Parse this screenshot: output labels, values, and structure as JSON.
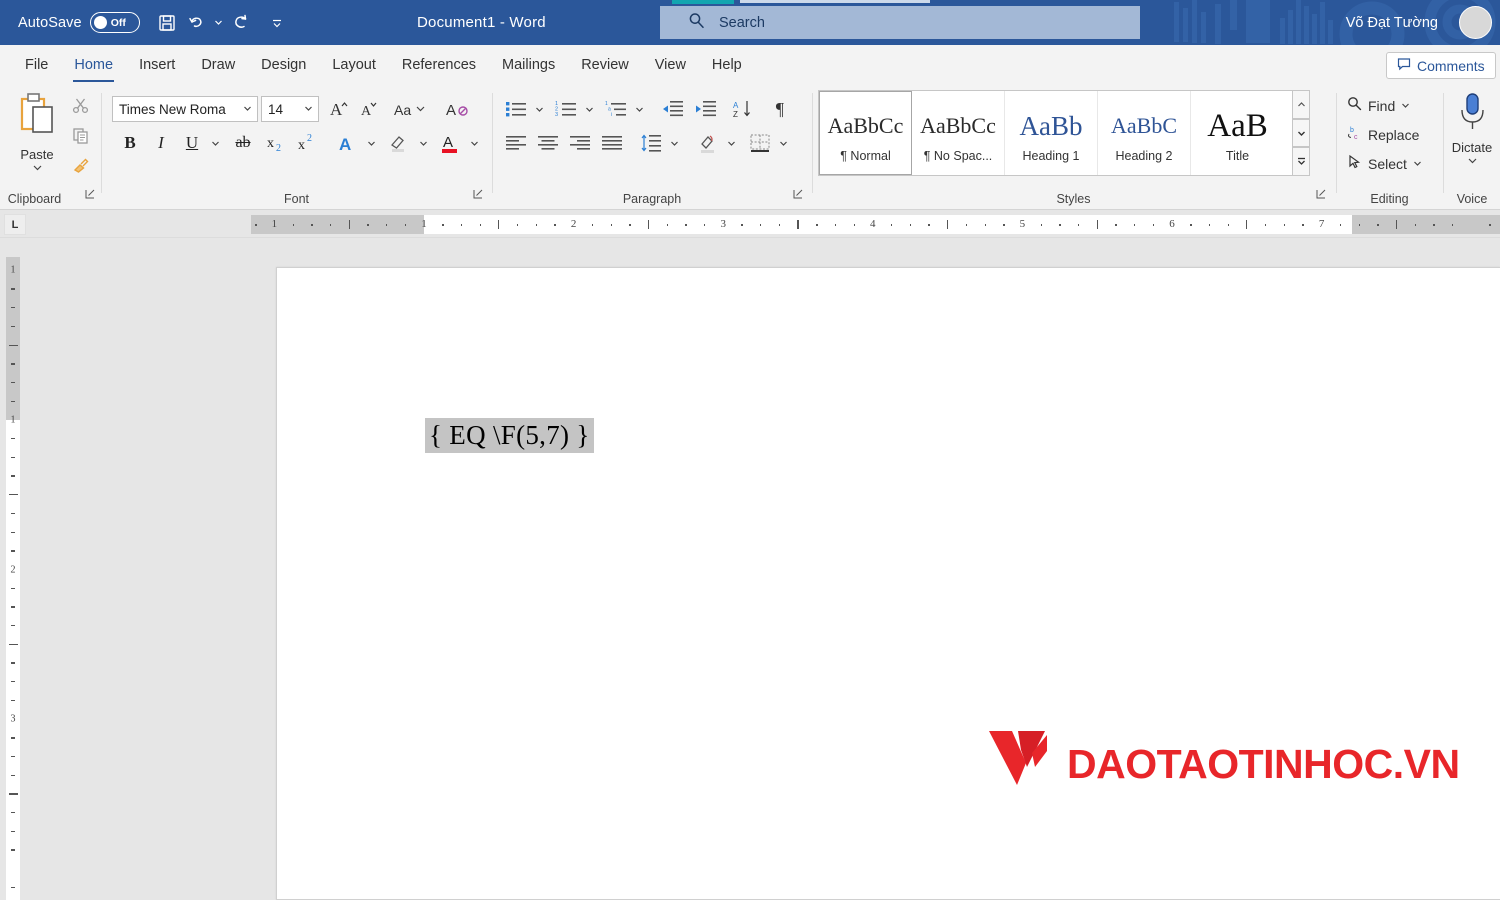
{
  "titlebar": {
    "autosave_label": "AutoSave",
    "autosave_state": "Off",
    "document_title": "Document1  -  Word",
    "search_placeholder": "Search",
    "search_value": "",
    "user_name": "Võ Đạt Tường",
    "qat": [
      {
        "name": "save-button",
        "label": "Save"
      },
      {
        "name": "undo-button",
        "label": "Undo"
      },
      {
        "name": "redo-button",
        "label": "Redo"
      },
      {
        "name": "customize-qat-button",
        "label": "Customize Quick Access Toolbar"
      }
    ],
    "accent_color": "#2b579a"
  },
  "ribbon_tabs": {
    "items": [
      {
        "label": "File",
        "active": false
      },
      {
        "label": "Home",
        "active": true
      },
      {
        "label": "Insert",
        "active": false
      },
      {
        "label": "Draw",
        "active": false
      },
      {
        "label": "Design",
        "active": false
      },
      {
        "label": "Layout",
        "active": false
      },
      {
        "label": "References",
        "active": false
      },
      {
        "label": "Mailings",
        "active": false
      },
      {
        "label": "Review",
        "active": false
      },
      {
        "label": "View",
        "active": false
      },
      {
        "label": "Help",
        "active": false
      }
    ],
    "comments_label": "Comments"
  },
  "ribbon": {
    "clipboard": {
      "group_label": "Clipboard",
      "paste_label": "Paste",
      "cut_label": "Cut",
      "copy_label": "Copy",
      "format_painter_label": "Format Painter"
    },
    "font": {
      "group_label": "Font",
      "font_name": "Times New Roma",
      "font_size": "14",
      "grow_font_label": "Grow Font",
      "shrink_font_label": "Shrink Font",
      "change_case_label": "Change Case",
      "clear_formatting_label": "Clear All Formatting",
      "bold_label": "B",
      "italic_label": "I",
      "underline_label": "U",
      "strikethrough_label": "ab",
      "subscript_label": "x",
      "superscript_label": "x",
      "text_effects_label": "A",
      "highlight_label": "Text Highlight Color",
      "font_color_label": "Font Color",
      "font_color_value": "#e81123"
    },
    "paragraph": {
      "group_label": "Paragraph",
      "bullets_label": "Bullets",
      "numbering_label": "Numbering",
      "multilevel_label": "Multilevel List",
      "decrease_indent_label": "Decrease Indent",
      "increase_indent_label": "Increase Indent",
      "sort_label": "Sort",
      "show_marks_label": "¶",
      "align_left_label": "Align Left",
      "align_center_label": "Center",
      "align_right_label": "Align Right",
      "justify_label": "Justify",
      "justify_selected": true,
      "line_spacing_label": "Line and Paragraph Spacing",
      "shading_label": "Shading",
      "borders_label": "Borders"
    },
    "styles": {
      "group_label": "Styles",
      "items": [
        {
          "preview": "AaBbCc",
          "name": "¶ Normal",
          "selected": true,
          "color": "#2b2b2b",
          "size": "22px"
        },
        {
          "preview": "AaBbCc",
          "name": "¶ No Spac...",
          "selected": false,
          "color": "#2b2b2b",
          "size": "22px"
        },
        {
          "preview": "AaBb",
          "name": "Heading 1",
          "selected": false,
          "color": "#2f5496",
          "size": "27px"
        },
        {
          "preview": "AaBbC",
          "name": "Heading 2",
          "selected": false,
          "color": "#2f5496",
          "size": "22px"
        },
        {
          "preview": "AaB",
          "name": "Title",
          "selected": false,
          "color": "#111111",
          "size": "33px"
        }
      ],
      "scroll_up_label": "Scroll Up",
      "scroll_down_label": "Scroll Down",
      "more_label": "More Styles"
    },
    "editing": {
      "group_label": "Editing",
      "find_label": "Find",
      "replace_label": "Replace",
      "select_label": "Select"
    },
    "voice": {
      "group_label": "Voice",
      "dictate_label": "Dictate"
    }
  },
  "ruler": {
    "tabstop_indicator": "L",
    "horizontal_marks": [
      "1",
      "1",
      "2",
      "3",
      "4",
      "5",
      "6",
      "7"
    ],
    "vertical_marks": [
      "1",
      "1",
      "2",
      "3"
    ],
    "units": "inches"
  },
  "document": {
    "field_code": "{ EQ \\F(5,7) }",
    "logo_text": "DAOTAOTINHOC.VN",
    "logo_color": "#e8262a"
  }
}
